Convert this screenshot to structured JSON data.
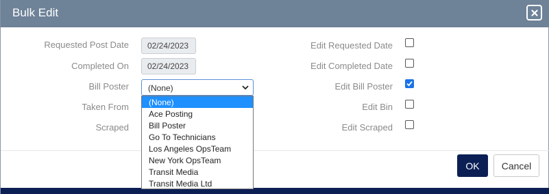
{
  "dialog": {
    "title": "Bulk Edit",
    "close_icon": "close-icon"
  },
  "left_fields": {
    "requested_post_date": {
      "label": "Requested Post Date",
      "value": "02/24/2023"
    },
    "completed_on": {
      "label": "Completed On",
      "value": "02/24/2023"
    },
    "bill_poster": {
      "label": "Bill Poster",
      "selected": "(None)"
    },
    "taken_from": {
      "label": "Taken From"
    },
    "scraped": {
      "label": "Scraped"
    }
  },
  "dropdown": {
    "options": [
      "(None)",
      "Ace Posting",
      "Bill Poster",
      "Go To Technicians",
      "Los Angeles OpsTeam",
      "New York OpsTeam",
      "Transit Media",
      "Transit Media Ltd"
    ],
    "highlighted": "(None)"
  },
  "right_fields": {
    "edit_requested_date": {
      "label": "Edit Requested Date",
      "checked": false
    },
    "edit_completed_date": {
      "label": "Edit Completed Date",
      "checked": false
    },
    "edit_bill_poster": {
      "label": "Edit Bill Poster",
      "checked": true
    },
    "edit_bin": {
      "label": "Edit Bin",
      "checked": false
    },
    "edit_scraped": {
      "label": "Edit Scraped",
      "checked": false
    }
  },
  "footer": {
    "ok_label": "OK",
    "cancel_label": "Cancel"
  },
  "colors": {
    "titlebar": "#6e8298",
    "primary": "#0c1f55",
    "checkbox_checked": "#1a73e8",
    "option_highlight": "#1e90ff"
  }
}
